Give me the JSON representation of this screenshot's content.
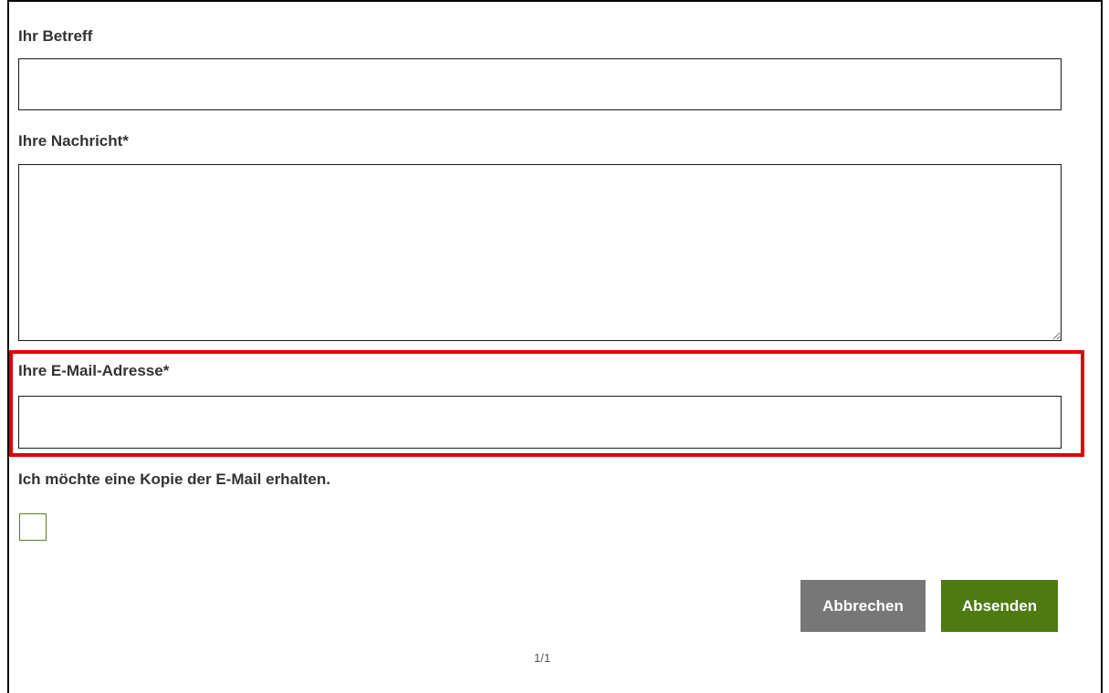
{
  "form": {
    "subject": {
      "label": "Ihr Betreff",
      "value": ""
    },
    "message": {
      "label": "Ihre Nachricht*",
      "value": ""
    },
    "email": {
      "label": "Ihre E-Mail-Adresse*",
      "value": ""
    },
    "copy": {
      "label": "Ich möchte eine Kopie der E-Mail erhalten.",
      "checked": false
    },
    "buttons": {
      "cancel_label": "Abbrechen",
      "submit_label": "Absenden"
    }
  },
  "pagination": {
    "text": "1/1"
  },
  "colors": {
    "highlight": "#e00000",
    "submit_button": "#4e7a12",
    "cancel_button": "#777777",
    "checkbox_border": "#55801f"
  }
}
